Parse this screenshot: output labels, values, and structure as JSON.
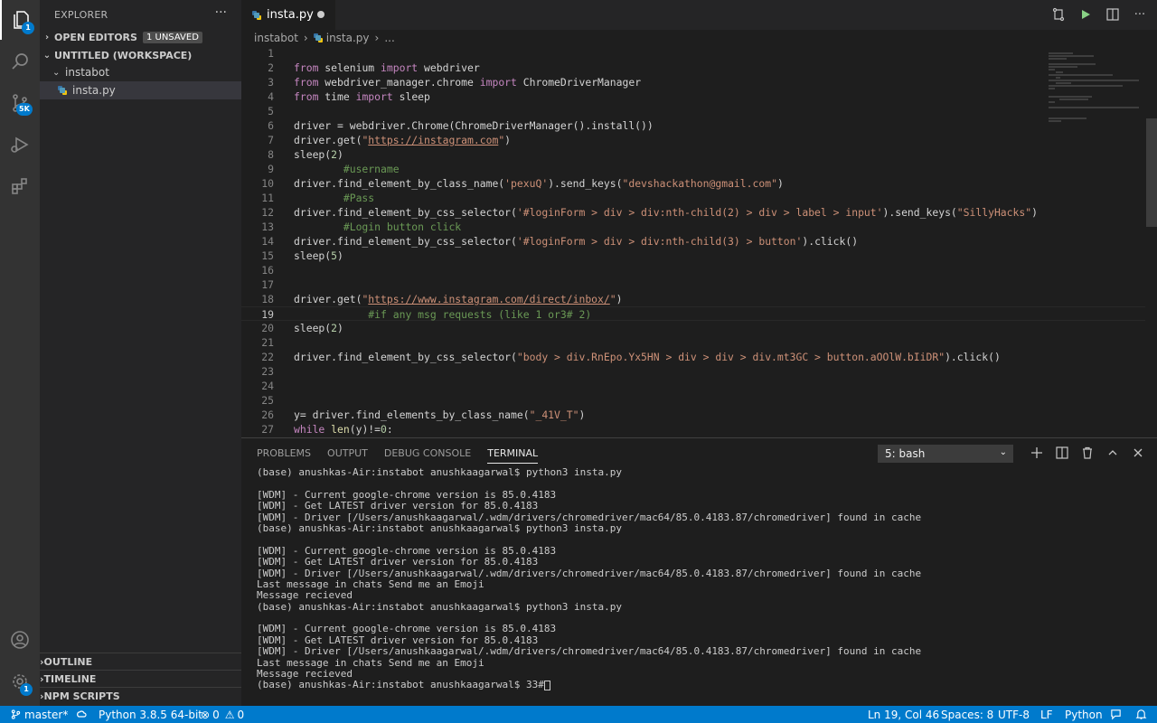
{
  "activity": {
    "explorer_badge": "1",
    "scm_badge": "5K",
    "settings_badge": "1"
  },
  "sidebar": {
    "title": "EXPLORER",
    "more": "···",
    "open_editors": "OPEN EDITORS",
    "unsaved": "1 UNSAVED",
    "workspace": "UNTITLED (WORKSPACE)",
    "folder": "instabot",
    "file": "insta.py",
    "outline": "OUTLINE",
    "timeline": "TIMELINE",
    "npm": "NPM SCRIPTS"
  },
  "editor": {
    "tab": "insta.py",
    "breadcrumb": {
      "folder": "instabot",
      "sep": "›",
      "file": "insta.py",
      "more": "..."
    }
  },
  "code_lines": [
    {
      "n": "1",
      "t": ""
    },
    {
      "n": "2",
      "t": "from selenium import webdriver"
    },
    {
      "n": "3",
      "t": "from webdriver_manager.chrome import ChromeDriverManager"
    },
    {
      "n": "4",
      "t": "from time import sleep"
    },
    {
      "n": "5",
      "t": ""
    },
    {
      "n": "6",
      "t": "driver = webdriver.Chrome(ChromeDriverManager().install())"
    },
    {
      "n": "7",
      "t": "driver.get(\"https://instagram.com\")"
    },
    {
      "n": "8",
      "t": "sleep(2)"
    },
    {
      "n": "9",
      "t": "        #username"
    },
    {
      "n": "10",
      "t": "driver.find_element_by_class_name('pexuQ').send_keys(\"devshackathon@gmail.com\")"
    },
    {
      "n": "11",
      "t": "        #Pass"
    },
    {
      "n": "12",
      "t": "driver.find_element_by_css_selector('#loginForm > div > div:nth-child(2) > div > label > input').send_keys(\"SillyHacks\")"
    },
    {
      "n": "13",
      "t": "        #Login button click"
    },
    {
      "n": "14",
      "t": "driver.find_element_by_css_selector('#loginForm > div > div:nth-child(3) > button').click()"
    },
    {
      "n": "15",
      "t": "sleep(5)"
    },
    {
      "n": "16",
      "t": ""
    },
    {
      "n": "17",
      "t": ""
    },
    {
      "n": "18",
      "t": "driver.get(\"https://www.instagram.com/direct/inbox/\")"
    },
    {
      "n": "19",
      "t": "            #if any msg requests (like 1 or3# 2)"
    },
    {
      "n": "20",
      "t": "sleep(2)"
    },
    {
      "n": "21",
      "t": ""
    },
    {
      "n": "22",
      "t": "driver.find_element_by_css_selector(\"body > div.RnEpo.Yx5HN > div > div > div.mt3GC > button.aOOlW.bIiDR\").click()"
    },
    {
      "n": "23",
      "t": ""
    },
    {
      "n": "24",
      "t": ""
    },
    {
      "n": "25",
      "t": ""
    },
    {
      "n": "26",
      "t": "y= driver.find_elements_by_class_name(\"_41V_T\")"
    },
    {
      "n": "27",
      "t": "while len(y)!=0:"
    }
  ],
  "panel": {
    "tabs": [
      "PROBLEMS",
      "OUTPUT",
      "DEBUG CONSOLE",
      "TERMINAL"
    ],
    "active_tab": "TERMINAL",
    "terminal_select": "5: bash",
    "terminal_lines": [
      "(base) anushkas-Air:instabot anushkaagarwal$ python3 insta.py",
      "",
      "[WDM] - Current google-chrome version is 85.0.4183",
      "[WDM] - Get LATEST driver version for 85.0.4183",
      "[WDM] - Driver [/Users/anushkaagarwal/.wdm/drivers/chromedriver/mac64/85.0.4183.87/chromedriver] found in cache",
      "(base) anushkas-Air:instabot anushkaagarwal$ python3 insta.py",
      "",
      "[WDM] - Current google-chrome version is 85.0.4183",
      "[WDM] - Get LATEST driver version for 85.0.4183",
      "[WDM] - Driver [/Users/anushkaagarwal/.wdm/drivers/chromedriver/mac64/85.0.4183.87/chromedriver] found in cache",
      "Last message in chats Send me an Emoji",
      "Message recieved",
      "(base) anushkas-Air:instabot anushkaagarwal$ python3 insta.py",
      "",
      "[WDM] - Current google-chrome version is 85.0.4183",
      "[WDM] - Get LATEST driver version for 85.0.4183",
      "[WDM] - Driver [/Users/anushkaagarwal/.wdm/drivers/chromedriver/mac64/85.0.4183.87/chromedriver] found in cache",
      "Last message in chats Send me an Emoji",
      "Message recieved"
    ],
    "prompt_line": "(base) anushkas-Air:instabot anushkaagarwal$ 33#"
  },
  "status": {
    "branch": "master*",
    "python": "Python 3.8.5 64-bit",
    "errors": "0",
    "warnings": "0",
    "position": "Ln 19, Col 46",
    "spaces": "Spaces: 8",
    "encoding": "UTF-8",
    "eol": "LF",
    "language": "Python"
  },
  "colors": {
    "accent": "#007acc",
    "keyword": "#c586c0",
    "string": "#ce9178",
    "comment": "#6a9955"
  }
}
